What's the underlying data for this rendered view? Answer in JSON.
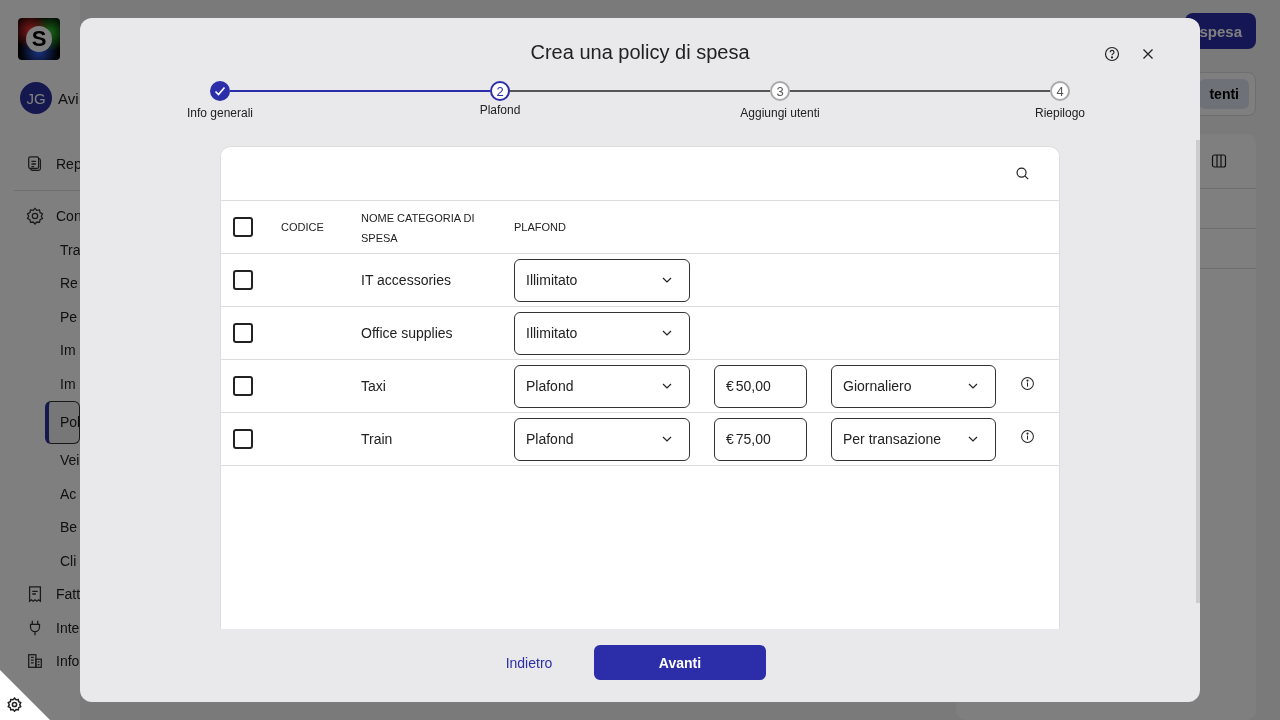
{
  "background": {
    "logo_letter": "S",
    "user": {
      "initials": "JG",
      "name": "Avi"
    },
    "sidebar_items": [
      {
        "label": "Rep",
        "kind": "section",
        "selected": false
      },
      {
        "label": "Con",
        "kind": "section",
        "selected": false
      },
      {
        "label": "Tra",
        "kind": "subitem",
        "selected": false
      },
      {
        "label": "Re",
        "kind": "subitem",
        "selected": false
      },
      {
        "label": "Pe",
        "kind": "subitem",
        "selected": false
      },
      {
        "label": "Im",
        "kind": "subitem",
        "selected": false
      },
      {
        "label": "Im",
        "kind": "subitem",
        "selected": false
      },
      {
        "label": "Pol",
        "kind": "subitem",
        "selected": true
      },
      {
        "label": "Vei",
        "kind": "subitem",
        "selected": false
      },
      {
        "label": "Ac",
        "kind": "subitem",
        "selected": false
      },
      {
        "label": "Be",
        "kind": "subitem",
        "selected": false
      },
      {
        "label": "Cli",
        "kind": "subitem",
        "selected": false
      },
      {
        "label": "Fatt",
        "kind": "section",
        "selected": false
      },
      {
        "label": "Inte",
        "kind": "section",
        "selected": false
      },
      {
        "label": "Info",
        "kind": "section",
        "selected": false
      }
    ],
    "primary_button": "spesa",
    "tab": "tenti"
  },
  "dialog": {
    "title": "Crea una policy di spesa",
    "steps": [
      {
        "label": "Info generali",
        "done": true,
        "selected": false
      },
      {
        "number": "2",
        "label": "Plafond",
        "done": false,
        "selected": true
      },
      {
        "number": "3",
        "label": "Aggiungi utenti",
        "done": false,
        "selected": false
      },
      {
        "number": "4",
        "label": "Riepilogo",
        "done": false,
        "selected": false
      }
    ],
    "table": {
      "columns": [
        "CODICE",
        "NOME CATEGORIA DI SPESA",
        "PLAFOND"
      ],
      "all_selected": false,
      "rows": [
        {
          "selected": false,
          "name": "IT accessories",
          "kind": "unlimited",
          "limit_type": "Illimitato"
        },
        {
          "selected": false,
          "name": "Office supplies",
          "kind": "unlimited",
          "limit_type": "Illimitato"
        },
        {
          "selected": false,
          "name": "Taxi",
          "kind": "limited",
          "limit_type": "Plafond",
          "currency": "€",
          "amount": "50,00",
          "period": "Giornaliero"
        },
        {
          "selected": false,
          "name": "Train",
          "kind": "limited",
          "limit_type": "Plafond",
          "currency": "€",
          "amount": "75,00",
          "period": "Per transazione"
        }
      ]
    },
    "back_link": "Indietro",
    "next_button": "Avanti"
  }
}
